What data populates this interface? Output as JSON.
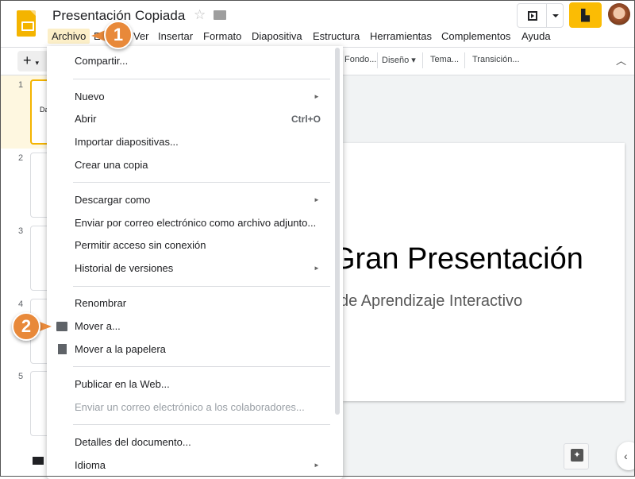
{
  "header": {
    "title": "Presentación Copiada",
    "share_icon": "lock-building-icon"
  },
  "menubar": [
    "Archivo",
    "Editar",
    "Ver",
    "Insertar",
    "Formato",
    "Diapositiva",
    "Estructura",
    "Herramientas",
    "Complementos",
    "Ayuda"
  ],
  "toolbar": {
    "add": "+",
    "fondo": "Fondo...",
    "diseno": "Diseño",
    "tema": "Tema...",
    "transicion": "Transición..."
  },
  "filmstrip": {
    "numbers": [
      "1",
      "2",
      "3",
      "4",
      "5"
    ],
    "thumb1_text": "Da"
  },
  "slide": {
    "title": "Gran Presentación",
    "subtitle": "de Aprendizaje Interactivo"
  },
  "file_menu": {
    "compartir": "Compartir...",
    "nuevo": "Nuevo",
    "abrir": "Abrir",
    "abrir_shortcut": "Ctrl+O",
    "importar": "Importar diapositivas...",
    "crear_copia": "Crear una copia",
    "descargar": "Descargar como",
    "enviar_adjunto": "Enviar por correo electrónico como archivo adjunto...",
    "sin_conexion": "Permitir acceso sin conexión",
    "historial": "Historial de versiones",
    "renombrar": "Renombrar",
    "mover": "Mover a...",
    "papelera": "Mover a la papelera",
    "publicar": "Publicar en la Web...",
    "enviar_colaboradores": "Enviar un correo electrónico a los colaboradores...",
    "detalles": "Detalles del documento...",
    "idioma": "Idioma",
    "submenu_arrow": "►"
  },
  "callouts": [
    "1",
    "2"
  ],
  "colors": {
    "accent": "#fbbc04",
    "callout": "#e8893a",
    "menu_highlight": "#fcefc8"
  }
}
